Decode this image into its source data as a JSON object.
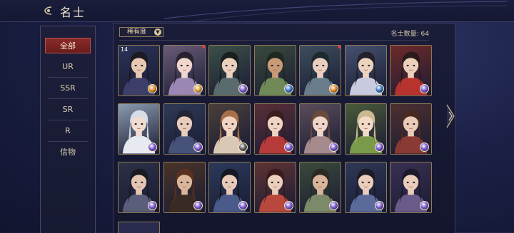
{
  "header": {
    "title": "名士"
  },
  "sidebar": {
    "items": [
      {
        "label": "全部",
        "active": true
      },
      {
        "label": "UR"
      },
      {
        "label": "SSR"
      },
      {
        "label": "SR"
      },
      {
        "label": "R"
      },
      {
        "label": "信物"
      }
    ]
  },
  "main": {
    "filter_label": "稀有度",
    "count_text": "名士数量: 64",
    "cards": [
      {
        "level": "14",
        "bg": "#2b3256",
        "skin": "#e7c9b2",
        "hair": "#1c1a22",
        "cloth": "#3d3f6a",
        "elem": "#e08a2a",
        "dot": false
      },
      {
        "level": "",
        "bg": "#6a5b78",
        "skin": "#f0d6cc",
        "hair": "#2a2230",
        "cloth": "#9a87b3",
        "elem": "#d9a03a",
        "dot": true
      },
      {
        "level": "",
        "bg": "#3c4f48",
        "skin": "#ebd0bd",
        "hair": "#1a1e1c",
        "cloth": "#5a6b6e",
        "elem": "#7a5ad0",
        "dot": false
      },
      {
        "level": "",
        "bg": "#3a4a3d",
        "skin": "#c99a76",
        "hair": "#1d2a1e",
        "cloth": "#6f8a58",
        "elem": "#3a78c8",
        "dot": false
      },
      {
        "level": "",
        "bg": "#3d4e5e",
        "skin": "#eacfbf",
        "hair": "#1f2a2e",
        "cloth": "#6a7d8d",
        "elem": "#e08a2a",
        "dot": true
      },
      {
        "level": "",
        "bg": "#45516e",
        "skin": "#ecd3c0",
        "hair": "#23202b",
        "cloth": "#c8cbe0",
        "elem": "#3a78c8",
        "dot": false
      },
      {
        "level": "",
        "bg": "#6e2a2a",
        "skin": "#ecd0bb",
        "hair": "#2a1a1a",
        "cloth": "#b7332e",
        "elem": "#7a5ad0",
        "dot": false
      },
      {
        "level": "",
        "bg": "#8a9bb0",
        "skin": "#f1dcd1",
        "hair": "#d7dde6",
        "cloth": "#e7eaf1",
        "elem": "#7a5ad0",
        "dot": false
      },
      {
        "level": "",
        "bg": "#2e3a55",
        "skin": "#e8cdbb",
        "hair": "#232536",
        "cloth": "#46527a",
        "elem": "#7a5ad0",
        "dot": false
      },
      {
        "level": "",
        "bg": "#4a3f3b",
        "skin": "#efd5c2",
        "hair": "#a8704a",
        "cloth": "#d9c9b4",
        "elem": "#5d5d5d",
        "dot": false
      },
      {
        "level": "",
        "bg": "#5a2f38",
        "skin": "#efd4c3",
        "hair": "#3a1e1e",
        "cloth": "#b73a3a",
        "elem": "#7a5ad0",
        "dot": false
      },
      {
        "level": "",
        "bg": "#5b4d5a",
        "skin": "#efd6c8",
        "hair": "#6a4a3a",
        "cloth": "#a58a8e",
        "elem": "#7a5ad0",
        "dot": false
      },
      {
        "level": "",
        "bg": "#4a5a3a",
        "skin": "#f2dac6",
        "hair": "#cbb890",
        "cloth": "#7a9a4a",
        "elem": "#7a5ad0",
        "dot": false
      },
      {
        "level": "",
        "bg": "#4e3030",
        "skin": "#e9cbb6",
        "hair": "#4a2a20",
        "cloth": "#8a3a35",
        "elem": "#7a5ad0",
        "dot": false
      },
      {
        "level": "",
        "bg": "#2b3146",
        "skin": "#e5c6b2",
        "hair": "#1a1a22",
        "cloth": "#5a5e7a",
        "elem": "#7a5ad0",
        "dot": false
      },
      {
        "level": "",
        "bg": "#4a3428",
        "skin": "#d9b59a",
        "hair": "#5a3020",
        "cloth": "#3a2a24",
        "elem": "#7a5ad0",
        "dot": false
      },
      {
        "level": "",
        "bg": "#2c3a5a",
        "skin": "#e7cbb8",
        "hair": "#151821",
        "cloth": "#4a5a8a",
        "elem": "#7a5ad0",
        "dot": false
      },
      {
        "level": "",
        "bg": "#5e3434",
        "skin": "#ebcfbc",
        "hair": "#3a1a1a",
        "cloth": "#b8473c",
        "elem": "#7a5ad0",
        "dot": false
      },
      {
        "level": "",
        "bg": "#3a4a3a",
        "skin": "#d8b49a",
        "hair": "#2a2a22",
        "cloth": "#7d8a6a",
        "elem": "#7a5ad0",
        "dot": false
      },
      {
        "level": "",
        "bg": "#2e3856",
        "skin": "#eacdba",
        "hair": "#1c1c26",
        "cloth": "#5a6a9a",
        "elem": "#7a5ad0",
        "dot": false
      },
      {
        "level": "",
        "bg": "#3a3052",
        "skin": "#e9ccba",
        "hair": "#1e1a2c",
        "cloth": "#6a5a8a",
        "elem": "#7a5ad0",
        "dot": false
      }
    ]
  },
  "colors": {
    "accent_red": "#8a2a2a",
    "gold_border": "#8d7a55",
    "notification": "#e53a3a"
  }
}
